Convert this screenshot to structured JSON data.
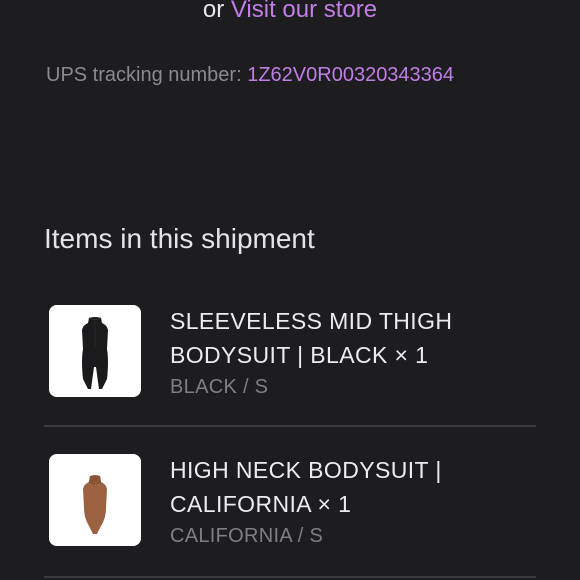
{
  "header": {
    "or_text": "or",
    "store_link": "Visit our store"
  },
  "tracking": {
    "label": "UPS tracking number:",
    "number": "1Z62V0R00320343364"
  },
  "shipment": {
    "title": "Items in this shipment",
    "items": [
      {
        "name_line1": "SLEEVELESS MID THIGH",
        "name_line2": "BODYSUIT | BLACK × 1",
        "variant": "BLACK / S",
        "thumbnail_icon": "black-bodysuit-image"
      },
      {
        "name_line1": "HIGH NECK BODYSUIT |",
        "name_line2": "CALIFORNIA × 1",
        "variant": "CALIFORNIA / S",
        "thumbnail_icon": "brown-bodysuit-image"
      }
    ]
  },
  "colors": {
    "background": "#1d1d20",
    "accent": "#c17ee6",
    "primary_text": "#ececee",
    "muted_text": "#7e7e83",
    "divider": "#3b3b3f"
  }
}
